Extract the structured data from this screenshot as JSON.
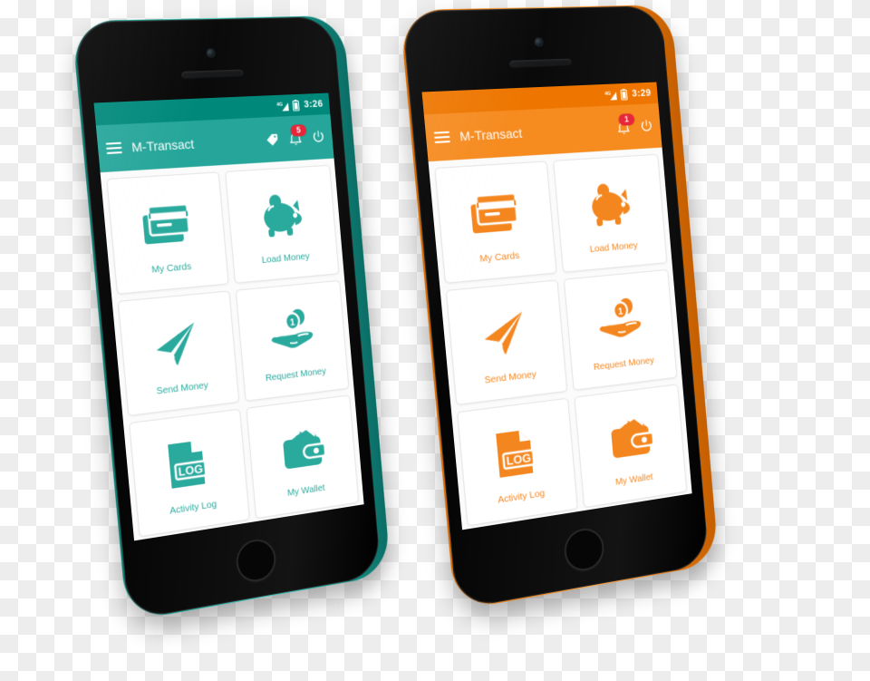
{
  "scene": {
    "description": "Two smartphone mockups displaying the M-Transact mobile wallet app home screen",
    "background": "transparent-checkerboard"
  },
  "phones": [
    {
      "id": "teal",
      "frame_color": "#1aa396",
      "accent": "#26a69a",
      "statusbar_color": "#00897b",
      "label_color": "#2aa99d",
      "statusbar": {
        "network": "4G",
        "signal_icon": "signal-bars-icon",
        "battery_icon": "battery-icon",
        "time": "3:26"
      },
      "appbar": {
        "menu_icon": "hamburger-menu-icon",
        "title": "M-Transact",
        "actions": [
          {
            "icon": "tag-icon",
            "name": "offers-tag",
            "badge": null
          },
          {
            "icon": "bell-icon",
            "name": "notifications",
            "badge": "5"
          },
          {
            "icon": "power-icon",
            "name": "logout",
            "badge": null
          }
        ]
      },
      "tiles": [
        {
          "icon": "credit-card-icon",
          "label": "My Cards"
        },
        {
          "icon": "piggy-bank-icon",
          "label": "Load Money"
        },
        {
          "icon": "paper-plane-icon",
          "label": "Send Money"
        },
        {
          "icon": "hand-coins-icon",
          "label": "Request Money"
        },
        {
          "icon": "log-document-icon",
          "label": "Activity Log"
        },
        {
          "icon": "wallet-icon",
          "label": "My Wallet"
        }
      ]
    },
    {
      "id": "orange",
      "frame_color": "#f07c0a",
      "accent": "#f68b1f",
      "statusbar_color": "#ee7600",
      "label_color": "#f4861f",
      "statusbar": {
        "network": "4G",
        "signal_icon": "signal-bars-icon",
        "battery_icon": "battery-icon",
        "time": "3:29"
      },
      "appbar": {
        "menu_icon": "hamburger-menu-icon",
        "title": "M-Transact",
        "actions": [
          {
            "icon": "bell-icon",
            "name": "notifications",
            "badge": "1"
          },
          {
            "icon": "power-icon",
            "name": "logout",
            "badge": null
          }
        ]
      },
      "tiles": [
        {
          "icon": "credit-card-icon",
          "label": "My Cards"
        },
        {
          "icon": "piggy-bank-icon",
          "label": "Load Money"
        },
        {
          "icon": "paper-plane-icon",
          "label": "Send Money"
        },
        {
          "icon": "hand-coins-icon",
          "label": "Request Money"
        },
        {
          "icon": "log-document-icon",
          "label": "Activity Log"
        },
        {
          "icon": "wallet-icon",
          "label": "My Wallet"
        }
      ]
    }
  ]
}
